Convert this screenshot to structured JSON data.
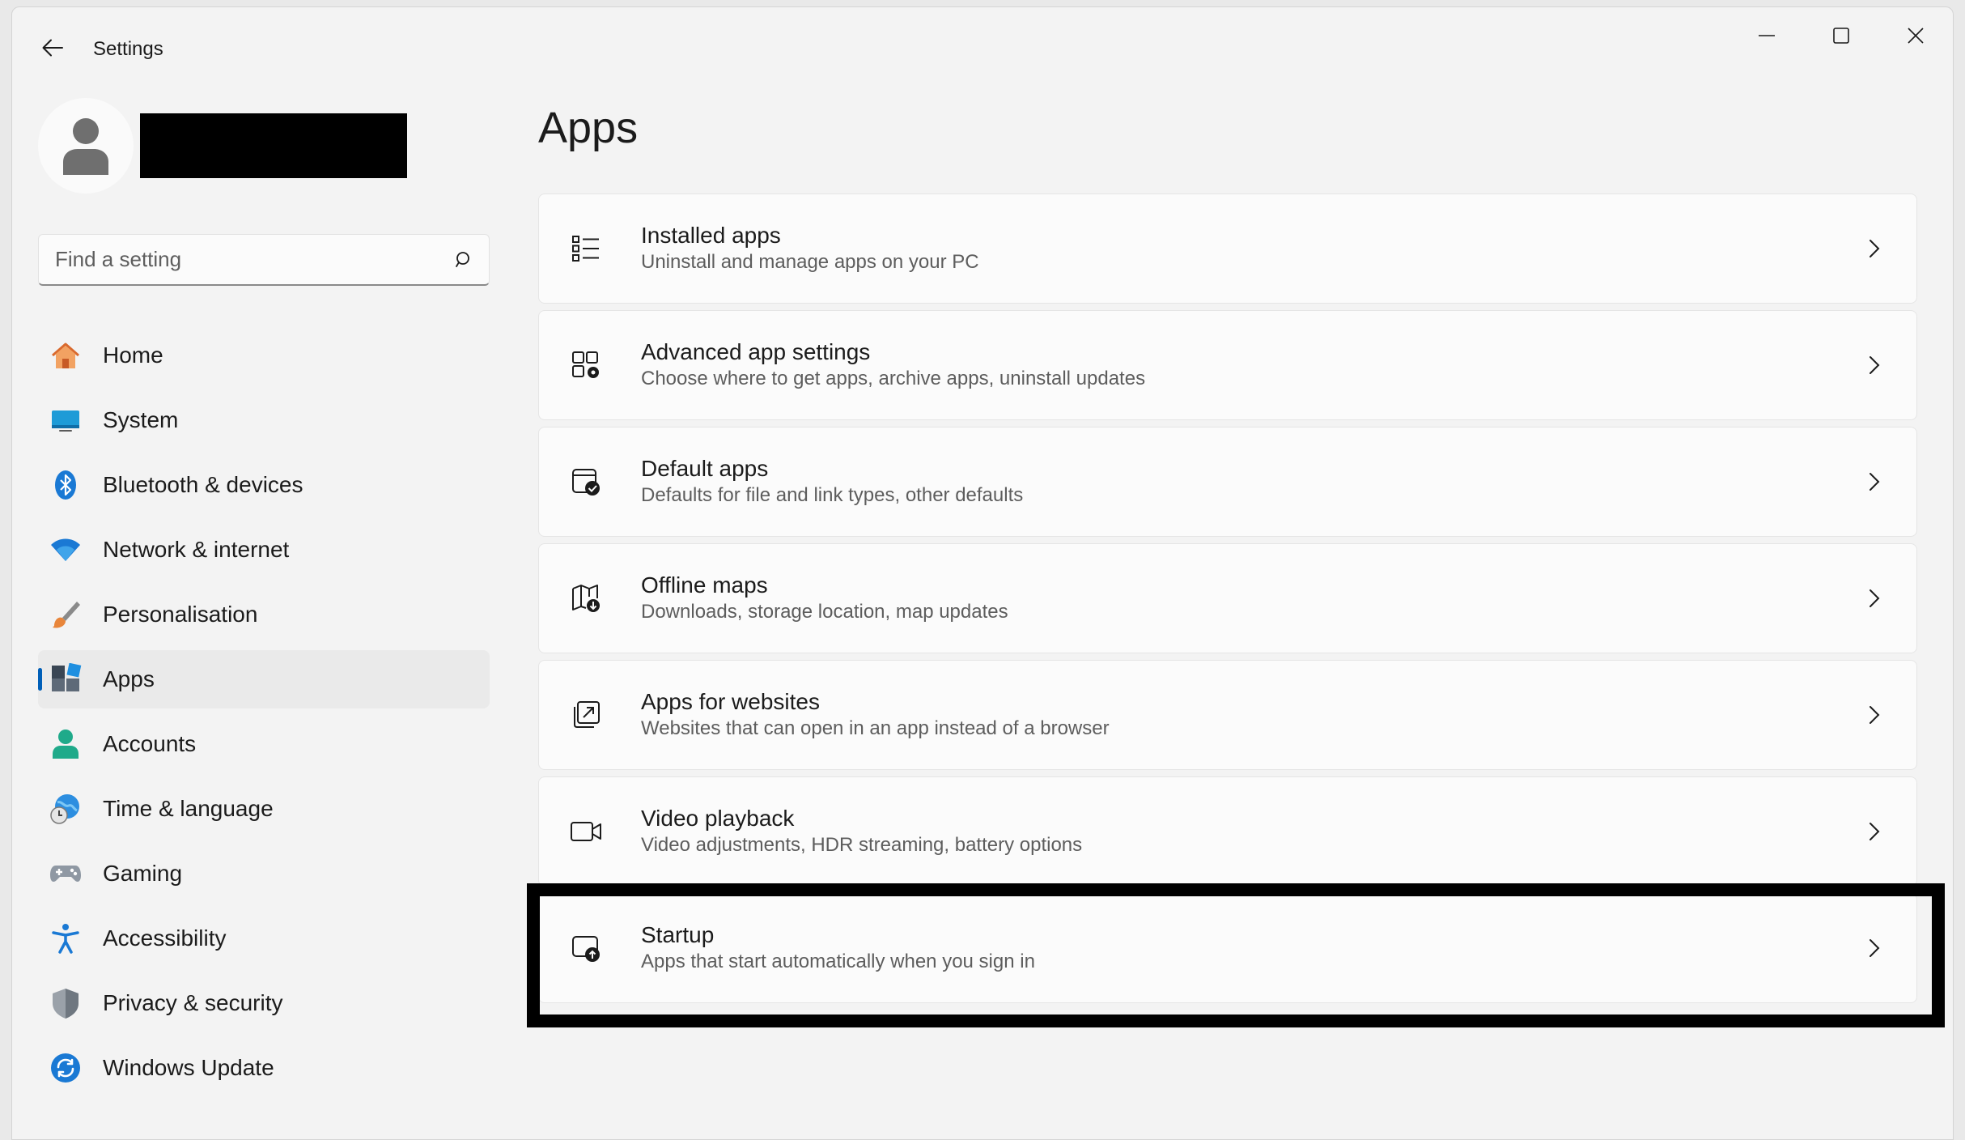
{
  "window": {
    "title": "Settings"
  },
  "search": {
    "placeholder": "Find a setting"
  },
  "sidebar": {
    "items": [
      {
        "label": "Home",
        "icon": "home-icon"
      },
      {
        "label": "System",
        "icon": "system-icon"
      },
      {
        "label": "Bluetooth & devices",
        "icon": "bluetooth-icon"
      },
      {
        "label": "Network & internet",
        "icon": "wifi-icon"
      },
      {
        "label": "Personalisation",
        "icon": "brush-icon"
      },
      {
        "label": "Apps",
        "icon": "apps-icon",
        "active": true
      },
      {
        "label": "Accounts",
        "icon": "person-icon"
      },
      {
        "label": "Time & language",
        "icon": "globe-clock-icon"
      },
      {
        "label": "Gaming",
        "icon": "gamepad-icon"
      },
      {
        "label": "Accessibility",
        "icon": "accessibility-icon"
      },
      {
        "label": "Privacy & security",
        "icon": "shield-icon"
      },
      {
        "label": "Windows Update",
        "icon": "update-icon"
      }
    ]
  },
  "main": {
    "title": "Apps",
    "cards": [
      {
        "title": "Installed apps",
        "subtitle": "Uninstall and manage apps on your PC",
        "icon": "list-icon"
      },
      {
        "title": "Advanced app settings",
        "subtitle": "Choose where to get apps, archive apps, uninstall updates",
        "icon": "app-settings-icon"
      },
      {
        "title": "Default apps",
        "subtitle": "Defaults for file and link types, other defaults",
        "icon": "default-apps-icon"
      },
      {
        "title": "Offline maps",
        "subtitle": "Downloads, storage location, map updates",
        "icon": "map-download-icon"
      },
      {
        "title": "Apps for websites",
        "subtitle": "Websites that can open in an app instead of a browser",
        "icon": "open-external-icon"
      },
      {
        "title": "Video playback",
        "subtitle": "Video adjustments, HDR streaming, battery options",
        "icon": "video-icon"
      },
      {
        "title": "Startup",
        "subtitle": "Apps that start automatically when you sign in",
        "icon": "startup-icon"
      }
    ]
  },
  "colors": {
    "accent": "#005fb8",
    "background": "#f3f3f3",
    "card": "#fbfbfb"
  }
}
